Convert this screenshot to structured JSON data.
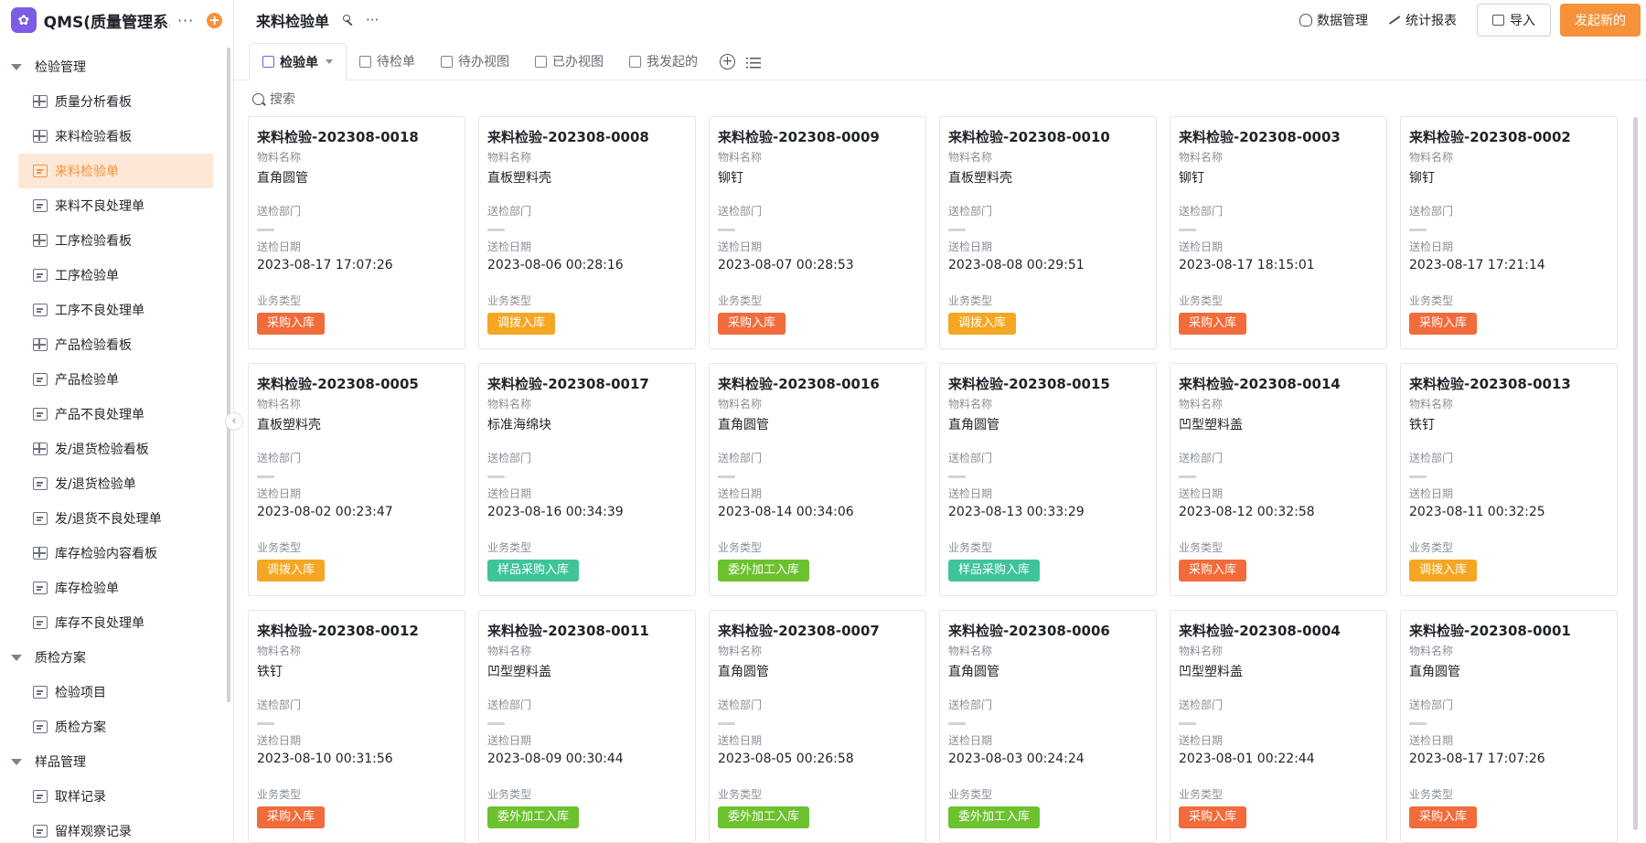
{
  "app": {
    "title": "QMS(质量管理系...",
    "more": "···",
    "add": "+"
  },
  "sidebar": {
    "groups": [
      {
        "label": "检验管理",
        "items": [
          {
            "label": "质量分析看板",
            "icon": "board"
          },
          {
            "label": "来料检验看板",
            "icon": "board"
          },
          {
            "label": "来料检验单",
            "icon": "form",
            "active": true
          },
          {
            "label": "来料不良处理单",
            "icon": "form"
          },
          {
            "label": "工序检验看板",
            "icon": "board"
          },
          {
            "label": "工序检验单",
            "icon": "form"
          },
          {
            "label": "工序不良处理单",
            "icon": "form"
          },
          {
            "label": "产品检验看板",
            "icon": "board"
          },
          {
            "label": "产品检验单",
            "icon": "form"
          },
          {
            "label": "产品不良处理单",
            "icon": "form"
          },
          {
            "label": "发/退货检验看板",
            "icon": "board"
          },
          {
            "label": "发/退货检验单",
            "icon": "form"
          },
          {
            "label": "发/退货不良处理单",
            "icon": "form"
          },
          {
            "label": "库存检验内容看板",
            "icon": "board"
          },
          {
            "label": "库存检验单",
            "icon": "form"
          },
          {
            "label": "库存不良处理单",
            "icon": "form"
          }
        ]
      },
      {
        "label": "质检方案",
        "items": [
          {
            "label": "检验项目",
            "icon": "form"
          },
          {
            "label": "质检方案",
            "icon": "form"
          }
        ]
      },
      {
        "label": "样品管理",
        "items": [
          {
            "label": "取样记录",
            "icon": "form"
          },
          {
            "label": "留样观察记录",
            "icon": "form"
          }
        ]
      }
    ],
    "collapse_icon": "‹"
  },
  "header": {
    "title": "来料检验单",
    "more": "···",
    "data_manage": "数据管理",
    "stats_report": "统计报表",
    "import": "导入",
    "new": "发起新的"
  },
  "tabs": [
    {
      "label": "检验单",
      "active": true
    },
    {
      "label": "待检单"
    },
    {
      "label": "待办视图"
    },
    {
      "label": "已办视图"
    },
    {
      "label": "我发起的"
    }
  ],
  "search": {
    "label": "搜索"
  },
  "field_labels": {
    "material": "物料名称",
    "dept": "送检部门",
    "date": "送检日期",
    "biz": "业务类型"
  },
  "colors": {
    "accent": "#f5923a",
    "采购入库": "#f26b3a",
    "调拨入库": "#f5a623",
    "委外加工入库": "#6cc12e",
    "样品采购入库": "#3fc49a"
  },
  "cards": [
    {
      "title": "来料检验-202308-0018",
      "material": "直角圆管",
      "date": "2023-08-17 17:07:26",
      "type": "采购入库"
    },
    {
      "title": "来料检验-202308-0008",
      "material": "直板塑料壳",
      "date": "2023-08-06 00:28:16",
      "type": "调拨入库"
    },
    {
      "title": "来料检验-202308-0009",
      "material": "铆钉",
      "date": "2023-08-07 00:28:53",
      "type": "采购入库"
    },
    {
      "title": "来料检验-202308-0010",
      "material": "直板塑料壳",
      "date": "2023-08-08 00:29:51",
      "type": "调拨入库"
    },
    {
      "title": "来料检验-202308-0003",
      "material": "铆钉",
      "date": "2023-08-17 18:15:01",
      "type": "采购入库"
    },
    {
      "title": "来料检验-202308-0002",
      "material": "铆钉",
      "date": "2023-08-17 17:21:14",
      "type": "采购入库"
    },
    {
      "title": "来料检验-202308-0005",
      "material": "直板塑料壳",
      "date": "2023-08-02 00:23:47",
      "type": "调拨入库"
    },
    {
      "title": "来料检验-202308-0017",
      "material": "标准海绵块",
      "date": "2023-08-16 00:34:39",
      "type": "样品采购入库"
    },
    {
      "title": "来料检验-202308-0016",
      "material": "直角圆管",
      "date": "2023-08-14 00:34:06",
      "type": "委外加工入库"
    },
    {
      "title": "来料检验-202308-0015",
      "material": "直角圆管",
      "date": "2023-08-13 00:33:29",
      "type": "样品采购入库"
    },
    {
      "title": "来料检验-202308-0014",
      "material": "凹型塑料盖",
      "date": "2023-08-12 00:32:58",
      "type": "采购入库"
    },
    {
      "title": "来料检验-202308-0013",
      "material": "铁钉",
      "date": "2023-08-11 00:32:25",
      "type": "调拨入库"
    },
    {
      "title": "来料检验-202308-0012",
      "material": "铁钉",
      "date": "2023-08-10 00:31:56",
      "type": "采购入库"
    },
    {
      "title": "来料检验-202308-0011",
      "material": "凹型塑料盖",
      "date": "2023-08-09 00:30:44",
      "type": "委外加工入库"
    },
    {
      "title": "来料检验-202308-0007",
      "material": "直角圆管",
      "date": "2023-08-05 00:26:58",
      "type": "委外加工入库"
    },
    {
      "title": "来料检验-202308-0006",
      "material": "直角圆管",
      "date": "2023-08-03 00:24:24",
      "type": "委外加工入库"
    },
    {
      "title": "来料检验-202308-0004",
      "material": "凹型塑料盖",
      "date": "2023-08-01 00:22:44",
      "type": "采购入库"
    },
    {
      "title": "来料检验-202308-0001",
      "material": "直角圆管",
      "date": "2023-08-17 17:07:26",
      "type": "采购入库"
    }
  ]
}
